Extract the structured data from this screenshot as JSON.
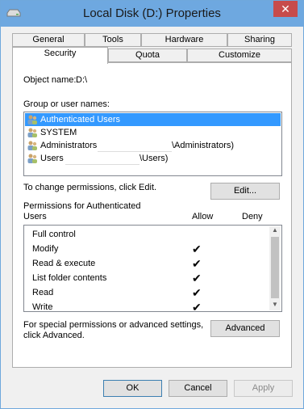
{
  "window": {
    "title": "Local Disk (D:) Properties",
    "close_glyph": "✕"
  },
  "tabs_row1": [
    "General",
    "Tools",
    "Hardware",
    "Sharing"
  ],
  "tabs_row2": [
    "Security",
    "Quota",
    "Customize"
  ],
  "object": {
    "label": "Object name:",
    "value": "D:\\"
  },
  "group": {
    "label": "Group or user names:",
    "users": [
      {
        "prefix": "Authenticated Users",
        "suffix": ""
      },
      {
        "prefix": "SYSTEM",
        "suffix": ""
      },
      {
        "prefix": "Administrators",
        "suffix": "\\Administrators)"
      },
      {
        "prefix": "Users",
        "suffix": "\\Users)"
      }
    ]
  },
  "change": {
    "text": "To change permissions, click Edit.",
    "edit_label": "Edit..."
  },
  "permissions": {
    "header_line1": "Permissions for Authenticated",
    "header_line2": "Users",
    "allow_label": "Allow",
    "deny_label": "Deny",
    "rows": [
      {
        "name": "Full control",
        "allow": false,
        "deny": false
      },
      {
        "name": "Modify",
        "allow": true,
        "deny": false
      },
      {
        "name": "Read & execute",
        "allow": true,
        "deny": false
      },
      {
        "name": "List folder contents",
        "allow": true,
        "deny": false
      },
      {
        "name": "Read",
        "allow": true,
        "deny": false
      },
      {
        "name": "Write",
        "allow": true,
        "deny": false
      }
    ],
    "check_glyph": "✔"
  },
  "advanced": {
    "line1": "For special permissions or advanced settings,",
    "line2": "click Advanced.",
    "button_label": "Advanced"
  },
  "footer": {
    "ok_label": "OK",
    "cancel_label": "Cancel",
    "apply_label": "Apply"
  },
  "colors": {
    "titlebar": "#6ea8e0",
    "selection": "#3399ff",
    "close": "#c74b4b"
  }
}
